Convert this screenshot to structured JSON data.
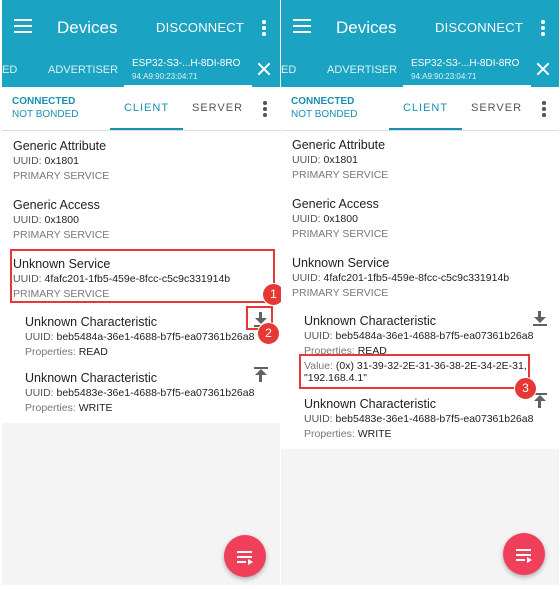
{
  "app": {
    "title": "Devices",
    "disconnect_label": "DISCONNECT",
    "tabs": {
      "partial": "ED",
      "advertiser": "ADVERTISER",
      "device_name": "ESP32-S3-...H-8DI-8RO",
      "device_mac": "94:A9:90:23:04:71"
    },
    "status": {
      "connected": "CONNECTED",
      "bonded": "NOT BONDED",
      "client_tab": "CLIENT",
      "server_tab": "SERVER"
    }
  },
  "services": [
    {
      "name": "Generic Attribute",
      "uuid_label": "UUID: ",
      "uuid": "0x1801",
      "type": "PRIMARY SERVICE"
    },
    {
      "name": "Generic Access",
      "uuid_label": "UUID: ",
      "uuid": "0x1800",
      "type": "PRIMARY SERVICE"
    },
    {
      "name": "Unknown Service",
      "uuid_label": "UUID: ",
      "uuid": "4fafc201-1fb5-459e-8fcc-c5c9c331914b",
      "type": "PRIMARY SERVICE"
    }
  ],
  "characteristics": [
    {
      "name": "Unknown Characteristic",
      "uuid_label": "UUID: ",
      "uuid": "beb5484a-36e1-4688-b7f5-ea07361b26a8",
      "props_label": "Properties: ",
      "props": "READ",
      "icon": "download-icon"
    },
    {
      "name": "Unknown Characteristic",
      "uuid_label": "UUID: ",
      "uuid": "beb5483e-36e1-4688-b7f5-ea07361b26a8",
      "props_label": "Properties: ",
      "props": "WRITE",
      "icon": "upload-icon"
    }
  ],
  "read_value": {
    "label": "Value: ",
    "line1": "(0x) 31-39-32-2E-31-36-38-2E-34-2E-31,",
    "line2": "\"192.168.4.1\""
  },
  "annotations": {
    "b1": "1",
    "b2": "2",
    "b3": "3",
    "color": "#e53935"
  },
  "colors": {
    "appbar": "#1aa3c2",
    "accent": "#1a8fb0",
    "fab": "#ef3f5a"
  }
}
